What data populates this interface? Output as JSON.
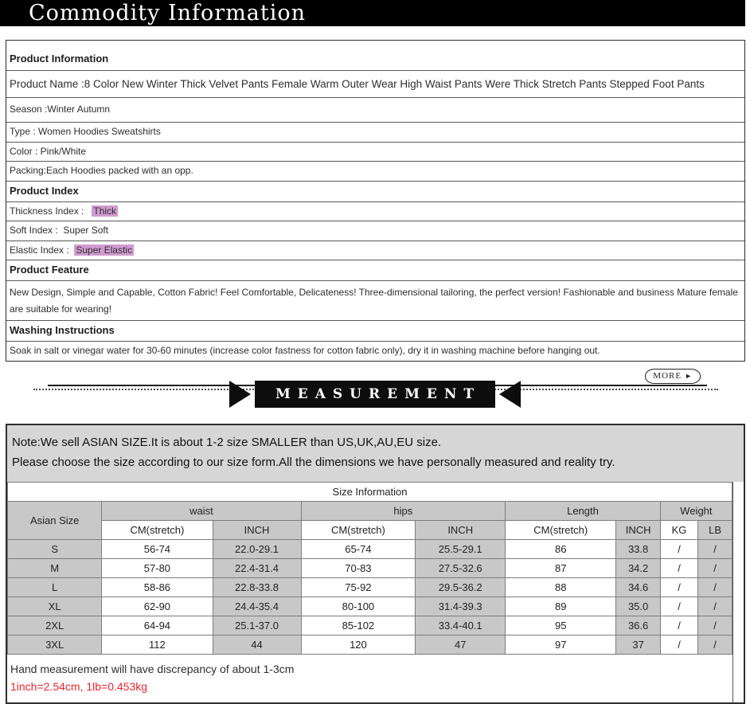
{
  "page_title": "Commodity Information",
  "sections": {
    "product_information": {
      "header": "Product Information",
      "rows": [
        "Product Name :8 Color New Winter Thick Velvet Pants Female Warm Outer Wear High Waist Pants Were Thick Stretch Pants Stepped Foot Pants",
        "Season :Winter Autumn",
        "Type : Women Hoodies Sweatshirts",
        "Color : Pink/White",
        "Packing:Each Hoodies packed with an opp."
      ]
    },
    "product_index": {
      "header": "Product Index",
      "rows": [
        {
          "label": "Thickness Index :   ",
          "value": "Thick",
          "highlight": true
        },
        {
          "label": "Soft Index :  ",
          "value": "Super Soft",
          "highlight": false
        },
        {
          "label": "Elastic Index :  ",
          "value": "Super Elastic",
          "highlight": true
        }
      ]
    },
    "product_feature": {
      "header": "Product Feature",
      "text": "New Design, Simple and Capable, Cotton Fabric! Feel Comfortable, Delicateness! Three-dimensional tailoring, the perfect version! Fashionable and business Mature female are suitable for wearing!"
    },
    "washing_instructions": {
      "header": "Washing Instructions",
      "text": "Soak in salt or vinegar water for 30-60 minutes (increase color fastness for cotton fabric only), dry it in washing machine before hanging out."
    }
  },
  "more_button": {
    "label": "MORE",
    "arrow_icon": "►"
  },
  "measurement_banner": {
    "label": "MEASUREMENT"
  },
  "size_note": {
    "line1": "Note:We sell ASIAN SIZE.It is about 1-2 size SMALLER than US,UK,AU,EU size.",
    "line2": "Please choose the size according to our size form.All the dimensions we have personally measured and reality try."
  },
  "chart_data": {
    "type": "table",
    "title": "Size Information",
    "size_column_header": "Asian Size",
    "group_headers": [
      "waist",
      "hips",
      "Length",
      "Weight"
    ],
    "sub_headers": [
      "CM(stretch)",
      "INCH",
      "CM(stretch)",
      "INCH",
      "CM(stretch)",
      "INCH",
      "KG",
      "LB"
    ],
    "col_widths_pct": [
      13.0,
      15.3,
      12.2,
      15.8,
      12.4,
      15.3,
      6.1,
      5.2,
      4.7
    ],
    "rows": [
      {
        "size": "S",
        "values": [
          "56-74",
          "22.0-29.1",
          "65-74",
          "25.5-29.1",
          "86",
          "33.8",
          "/",
          "/"
        ]
      },
      {
        "size": "M",
        "values": [
          "57-80",
          "22.4-31.4",
          "70-83",
          "27.5-32.6",
          "87",
          "34.2",
          "/",
          "/"
        ]
      },
      {
        "size": "L",
        "values": [
          "58-86",
          "22.8-33.8",
          "75-92",
          "29.5-36.2",
          "88",
          "34.6",
          "/",
          "/"
        ]
      },
      {
        "size": "XL",
        "values": [
          "62-90",
          "24.4-35.4",
          "80-100",
          "31.4-39.3",
          "89",
          "35.0",
          "/",
          "/"
        ]
      },
      {
        "size": "2XL",
        "values": [
          "64-94",
          "25.1-37.0",
          "85-102",
          "33.4-40.1",
          "95",
          "36.6",
          "/",
          "/"
        ]
      },
      {
        "size": "3XL",
        "values": [
          "112",
          "44",
          "120",
          "47",
          "97",
          "37",
          "/",
          "/"
        ]
      }
    ]
  },
  "size_footer": {
    "line1": "Hand measurement will have discrepancy of about 1-3cm",
    "line2": "1inch=2.54cm, 1lb=0.453kg"
  },
  "colors": {
    "highlight_purple": "#d19bd1",
    "weight_red": "#ff0000",
    "conversion_red": "#e8262d",
    "note_background": "#d6d6d6",
    "cell_gray": "#c8c8c8",
    "banner_black": "#000000"
  }
}
